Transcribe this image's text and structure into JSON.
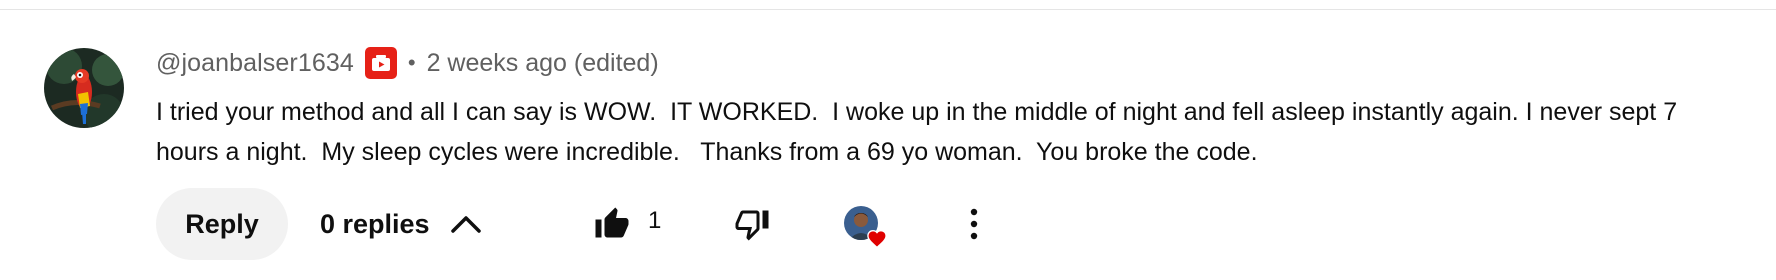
{
  "comment": {
    "author_handle": "@joanbalser1634",
    "separator": "•",
    "timestamp": "2 weeks ago (edited)",
    "text": "I tried your method and all I can say is WOW.  IT WORKED.  I woke up in the middle of night and fell asleep instantly again. I never sept 7 hours a night.  My sleep cycles were incredible.   Thanks from a 69 yo woman.  You broke the code.",
    "avatar_icon": "parrot-avatar",
    "badge_icon": "member-badge-icon",
    "badge_color": "#e62117"
  },
  "actions": {
    "reply_label": "Reply",
    "replies_label": "0 replies",
    "like_count": "1",
    "heart_color": "#e00000"
  }
}
